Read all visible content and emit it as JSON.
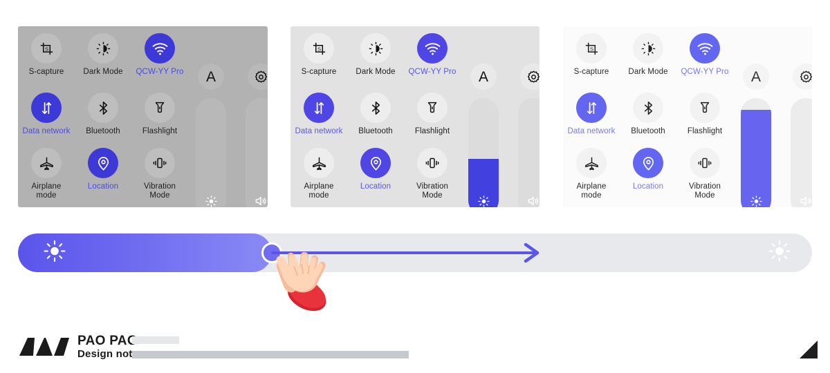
{
  "panels": [
    {
      "id": "panel-dark-theme",
      "theme": "dark",
      "tiles": [
        {
          "name": "s-capture",
          "label": "S-capture",
          "icon": "screenshot-capture-icon",
          "active": false,
          "accent": false
        },
        {
          "name": "dark-mode",
          "label": "Dark Mode",
          "icon": "dark-mode-icon",
          "active": false,
          "accent": false
        },
        {
          "name": "wifi",
          "label": "QCW-YY Pro",
          "icon": "wifi-icon",
          "active": true,
          "accent": true
        },
        {
          "name": "data-network",
          "label": "Data network",
          "icon": "data-network-icon",
          "active": true,
          "accent": true
        },
        {
          "name": "bluetooth",
          "label": "Bluetooth",
          "icon": "bluetooth-icon",
          "active": false,
          "accent": false
        },
        {
          "name": "flashlight",
          "label": "Flashlight",
          "icon": "flashlight-icon",
          "active": false,
          "accent": false
        },
        {
          "name": "airplane-mode",
          "label": "Airplane\nmode",
          "icon": "airplane-icon",
          "active": false,
          "accent": false
        },
        {
          "name": "location",
          "label": "Location",
          "icon": "location-pin-icon",
          "active": true,
          "accent": true
        },
        {
          "name": "vibration-mode",
          "label": "Vibration\nMode",
          "icon": "vibration-icon",
          "active": false,
          "accent": false
        }
      ],
      "top_icons": [
        {
          "name": "auto-brightness-a",
          "glyph": "A"
        },
        {
          "name": "settings-gear",
          "glyph": "gear-icon"
        }
      ],
      "sliders": [
        {
          "name": "brightness-slider",
          "icon": "sun-icon",
          "value": 0
        },
        {
          "name": "volume-slider",
          "icon": "speaker-icon",
          "value": 0
        }
      ]
    },
    {
      "id": "panel-mid-theme",
      "theme": "mid",
      "tiles": [
        {
          "name": "s-capture",
          "label": "S-capture",
          "icon": "screenshot-capture-icon",
          "active": false,
          "accent": false
        },
        {
          "name": "dark-mode",
          "label": "Dark Mode",
          "icon": "dark-mode-icon",
          "active": false,
          "accent": false
        },
        {
          "name": "wifi",
          "label": "QCW-YY Pro",
          "icon": "wifi-icon",
          "active": true,
          "accent": true
        },
        {
          "name": "data-network",
          "label": "Data network",
          "icon": "data-network-icon",
          "active": true,
          "accent": true
        },
        {
          "name": "bluetooth",
          "label": "Bluetooth",
          "icon": "bluetooth-icon",
          "active": false,
          "accent": false
        },
        {
          "name": "flashlight",
          "label": "Flashlight",
          "icon": "flashlight-icon",
          "active": false,
          "accent": false
        },
        {
          "name": "airplane-mode",
          "label": "Airplane\nmode",
          "icon": "airplane-icon",
          "active": false,
          "accent": false
        },
        {
          "name": "location",
          "label": "Location",
          "icon": "location-pin-icon",
          "active": true,
          "accent": true
        },
        {
          "name": "vibration-mode",
          "label": "Vibration\nMode",
          "icon": "vibration-icon",
          "active": false,
          "accent": false
        }
      ],
      "top_icons": [
        {
          "name": "auto-brightness-a",
          "glyph": "A"
        },
        {
          "name": "settings-gear",
          "glyph": "gear-icon"
        }
      ],
      "sliders": [
        {
          "name": "brightness-slider",
          "icon": "sun-icon",
          "value": 48
        },
        {
          "name": "volume-slider",
          "icon": "speaker-icon",
          "value": 0
        }
      ]
    },
    {
      "id": "panel-light-theme",
      "theme": "light",
      "tiles": [
        {
          "name": "s-capture",
          "label": "S-capture",
          "icon": "screenshot-capture-icon",
          "active": false,
          "accent": false
        },
        {
          "name": "dark-mode",
          "label": "Dark Mode",
          "icon": "dark-mode-icon",
          "active": false,
          "accent": false
        },
        {
          "name": "wifi",
          "label": "QCW-YY Pro",
          "icon": "wifi-icon",
          "active": true,
          "accent": true
        },
        {
          "name": "data-network",
          "label": "Data network",
          "icon": "data-network-icon",
          "active": true,
          "accent": true
        },
        {
          "name": "bluetooth",
          "label": "Bluetooth",
          "icon": "bluetooth-icon",
          "active": false,
          "accent": false
        },
        {
          "name": "flashlight",
          "label": "Flashlight",
          "icon": "flashlight-icon",
          "active": false,
          "accent": false
        },
        {
          "name": "airplane-mode",
          "label": "Airplane\nmode",
          "icon": "airplane-icon",
          "active": false,
          "accent": false
        },
        {
          "name": "location",
          "label": "Location",
          "icon": "location-pin-icon",
          "active": true,
          "accent": true
        },
        {
          "name": "vibration-mode",
          "label": "Vibration\nMode",
          "icon": "vibration-icon",
          "active": false,
          "accent": false
        }
      ],
      "top_icons": [
        {
          "name": "auto-brightness-a",
          "glyph": "A"
        },
        {
          "name": "settings-gear",
          "glyph": "gear-icon"
        }
      ],
      "sliders": [
        {
          "name": "brightness-slider",
          "icon": "sun-icon",
          "value": 90
        },
        {
          "name": "volume-slider",
          "icon": "speaker-icon",
          "value": 0
        }
      ]
    }
  ],
  "brightness_bar": {
    "name": "brightness-drag-slider",
    "value_percent": 32,
    "left_icon": "sun-icon",
    "right_icon": "sun-icon",
    "gesture": "drag-right",
    "cursor": "hand-pointer-icon",
    "arrow": "right-arrow-icon"
  },
  "footer": {
    "logo_mark": "pao-pao-logo-mark",
    "brand_line1": "PAO PAO",
    "brand_line2": "Design notes",
    "corner_mark": "corner-triangle-icon"
  },
  "colors": {
    "accent_dark": "#3d39d6",
    "accent_mid": "#4f46e5",
    "accent_light": "#6366f1",
    "slider_gradient_start": "#5b54ec",
    "slider_gradient_end": "#8a8af5",
    "track": "#e8e9ec",
    "panel_dark": "#b2b2b2",
    "panel_mid": "#e2e2e2",
    "panel_light": "#fbfbfb",
    "cursor_red": "#e03040"
  }
}
